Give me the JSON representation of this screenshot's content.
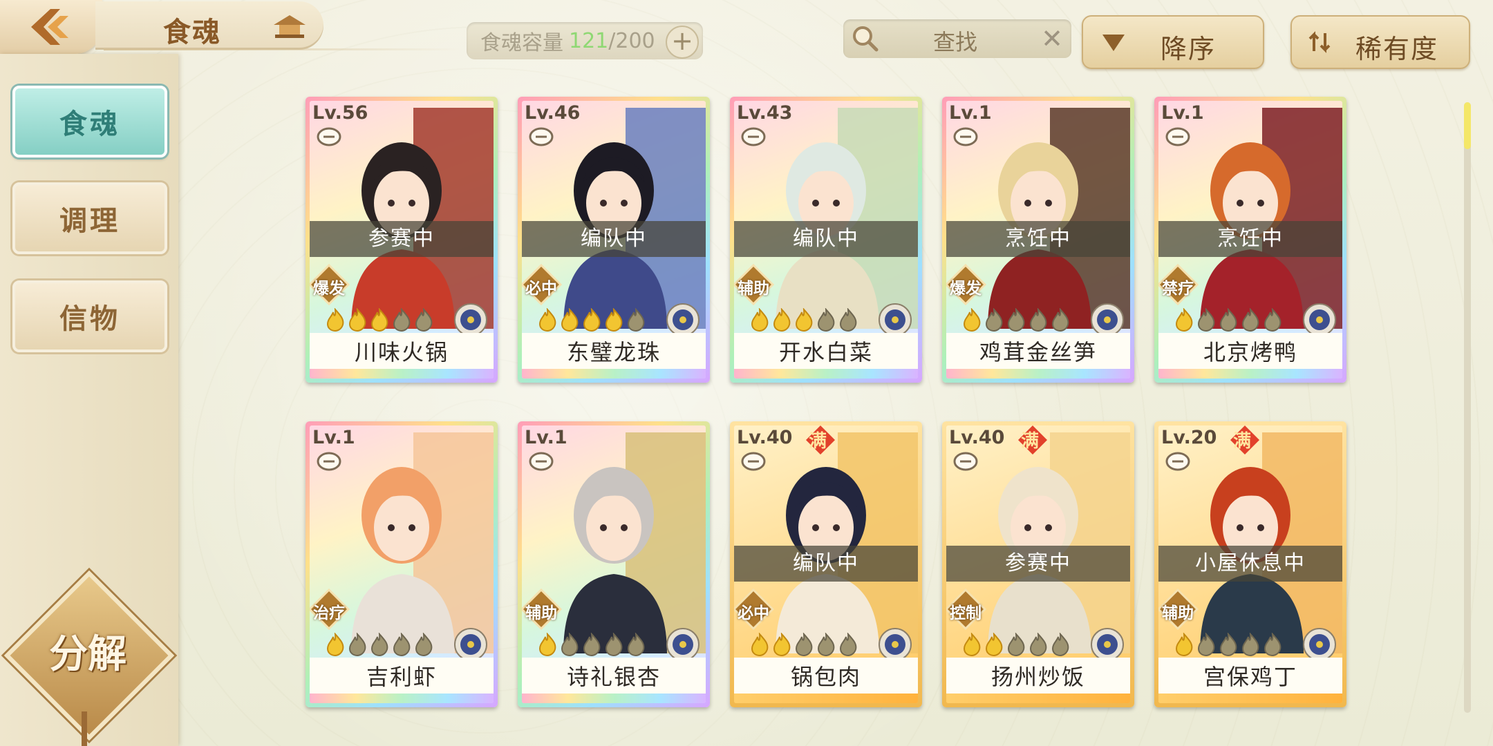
{
  "header": {
    "title": "食魂",
    "capacity": {
      "label": "食魂容量",
      "current": "121",
      "max": "/200"
    },
    "search_label": "查找",
    "sort_order_label": "降序",
    "sort_key_label": "稀有度"
  },
  "sidebar": {
    "tabs": [
      {
        "label": "食魂",
        "active": true
      },
      {
        "label": "调理",
        "active": false
      },
      {
        "label": "信物",
        "active": false
      }
    ],
    "decompose_label": "分解"
  },
  "cards": [
    {
      "level": "Lv.56",
      "status": "参赛中",
      "role": "爆发",
      "name": "川味火锅",
      "stars": 3,
      "max_stars": 5,
      "frame": "rainbow",
      "maxed": false,
      "hair": "#2a2222",
      "accent": "#c83c2a",
      "bg": "#a23a2e"
    },
    {
      "level": "Lv.46",
      "status": "编队中",
      "role": "必中",
      "name": "东璧龙珠",
      "stars": 4,
      "max_stars": 5,
      "frame": "rainbow",
      "maxed": false,
      "hair": "#1d1b24",
      "accent": "#3f4a8a",
      "bg": "#6a7fc0"
    },
    {
      "level": "Lv.43",
      "status": "编队中",
      "role": "辅助",
      "name": "开水白菜",
      "stars": 3,
      "max_stars": 5,
      "frame": "rainbow",
      "maxed": false,
      "hair": "#dfe9e2",
      "accent": "#e8e0c4",
      "bg": "#c7dbb6"
    },
    {
      "level": "Lv.1",
      "status": "烹饪中",
      "role": "爆发",
      "name": "鸡茸金丝笋",
      "stars": 1,
      "max_stars": 5,
      "frame": "rainbow",
      "maxed": false,
      "hair": "#e9d39a",
      "accent": "#8f2222",
      "bg": "#5a3a2a"
    },
    {
      "level": "Lv.1",
      "status": "烹饪中",
      "role": "禁疗",
      "name": "北京烤鸭",
      "stars": 1,
      "max_stars": 5,
      "frame": "rainbow",
      "maxed": false,
      "hair": "#d66a2c",
      "accent": "#a4222a",
      "bg": "#7d1f24"
    },
    {
      "level": "Lv.1",
      "status": "",
      "role": "治疗",
      "name": "吉利虾",
      "stars": 1,
      "max_stars": 5,
      "frame": "rainbow",
      "maxed": false,
      "hair": "#f2a068",
      "accent": "#e9e1d8",
      "bg": "#f6c69a"
    },
    {
      "level": "Lv.1",
      "status": "",
      "role": "辅助",
      "name": "诗礼银杏",
      "stars": 1,
      "max_stars": 5,
      "frame": "rainbow",
      "maxed": false,
      "hair": "#c9c4c0",
      "accent": "#2a2e3c",
      "bg": "#d8c07a"
    },
    {
      "level": "Lv.40",
      "status": "编队中",
      "role": "必中",
      "name": "锅包肉",
      "stars": 2,
      "max_stars": 5,
      "frame": "gold",
      "maxed": true,
      "maxed_label": "满",
      "hair": "#23263e",
      "accent": "#f4ead8",
      "bg": "#f2c468"
    },
    {
      "level": "Lv.40",
      "status": "参赛中",
      "role": "控制",
      "name": "扬州炒饭",
      "stars": 2,
      "max_stars": 5,
      "frame": "gold",
      "maxed": true,
      "maxed_label": "满",
      "hair": "#efe3cb",
      "accent": "#e8e0cc",
      "bg": "#f4d48e"
    },
    {
      "level": "Lv.20",
      "status": "小屋休息中",
      "role": "辅助",
      "name": "宫保鸡丁",
      "stars": 1,
      "max_stars": 5,
      "frame": "gold",
      "maxed": true,
      "maxed_label": "满",
      "hair": "#c8401e",
      "accent": "#2a3a4a",
      "bg": "#f2b864"
    }
  ],
  "scroll_position": 0.0,
  "colors": {
    "accent_teal": "#85cfc4",
    "capacity_current": "#8fd873",
    "brown_text": "#6e4b24"
  }
}
